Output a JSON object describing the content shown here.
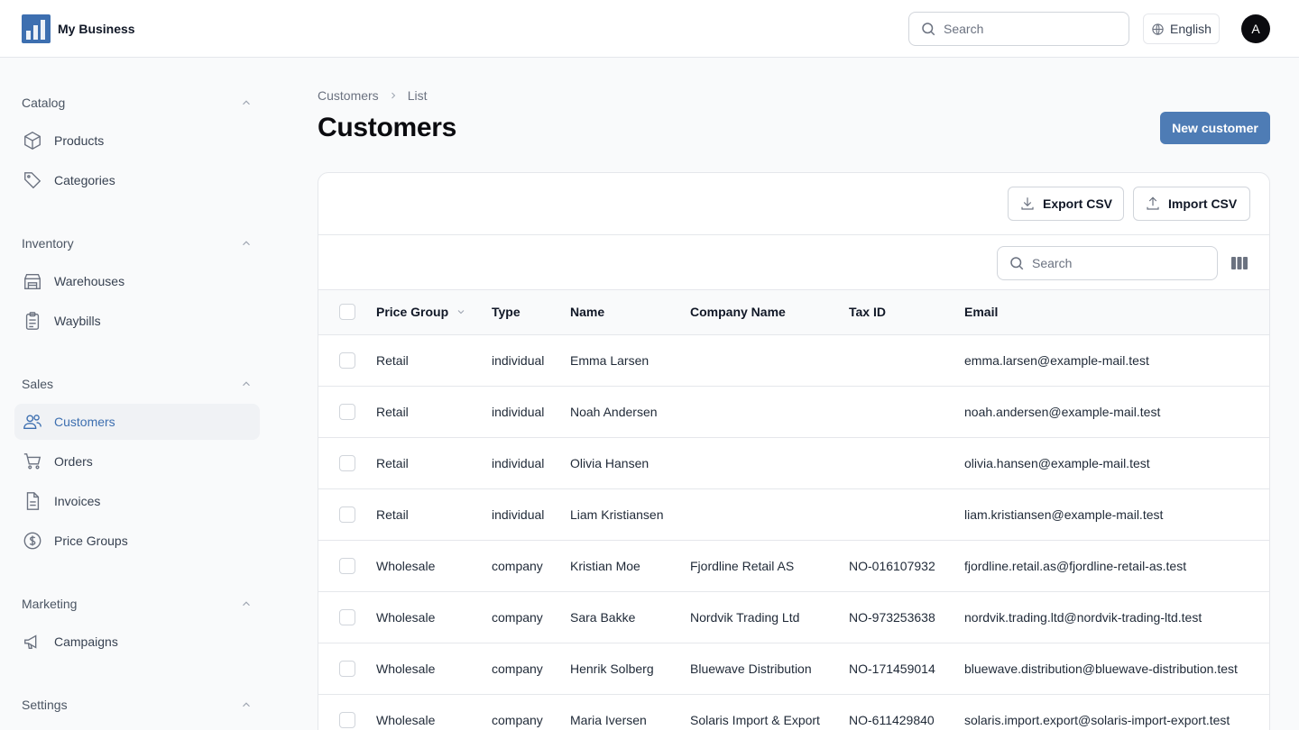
{
  "brand": {
    "name": "My Business"
  },
  "header": {
    "search_placeholder": "Search",
    "language": "English",
    "avatar_initial": "A"
  },
  "sidebar": {
    "groups": [
      {
        "label": "Catalog",
        "items": [
          {
            "label": "Products",
            "icon": "box-icon"
          },
          {
            "label": "Categories",
            "icon": "tag-icon"
          }
        ]
      },
      {
        "label": "Inventory",
        "items": [
          {
            "label": "Warehouses",
            "icon": "warehouse-icon"
          },
          {
            "label": "Waybills",
            "icon": "clipboard-icon"
          }
        ]
      },
      {
        "label": "Sales",
        "items": [
          {
            "label": "Customers",
            "icon": "users-icon",
            "active": true
          },
          {
            "label": "Orders",
            "icon": "cart-icon"
          },
          {
            "label": "Invoices",
            "icon": "document-icon"
          },
          {
            "label": "Price Groups",
            "icon": "dollar-icon"
          }
        ]
      },
      {
        "label": "Marketing",
        "items": [
          {
            "label": "Campaigns",
            "icon": "megaphone-icon"
          }
        ]
      },
      {
        "label": "Settings",
        "items": []
      }
    ]
  },
  "breadcrumb": {
    "parent": "Customers",
    "current": "List"
  },
  "page": {
    "title": "Customers",
    "new_button": "New customer"
  },
  "toolbar": {
    "export_label": "Export CSV",
    "import_label": "Import CSV"
  },
  "table": {
    "search_placeholder": "Search",
    "columns": [
      "Price Group",
      "Type",
      "Name",
      "Company Name",
      "Tax ID",
      "Email"
    ],
    "rows": [
      {
        "price_group": "Retail",
        "type": "individual",
        "name": "Emma Larsen",
        "company": "",
        "tax_id": "",
        "email": "emma.larsen@example-mail.test"
      },
      {
        "price_group": "Retail",
        "type": "individual",
        "name": "Noah Andersen",
        "company": "",
        "tax_id": "",
        "email": "noah.andersen@example-mail.test"
      },
      {
        "price_group": "Retail",
        "type": "individual",
        "name": "Olivia Hansen",
        "company": "",
        "tax_id": "",
        "email": "olivia.hansen@example-mail.test"
      },
      {
        "price_group": "Retail",
        "type": "individual",
        "name": "Liam Kristiansen",
        "company": "",
        "tax_id": "",
        "email": "liam.kristiansen@example-mail.test"
      },
      {
        "price_group": "Wholesale",
        "type": "company",
        "name": "Kristian Moe",
        "company": "Fjordline Retail AS",
        "tax_id": "NO-016107932",
        "email": "fjordline.retail.as@fjordline-retail-as.test"
      },
      {
        "price_group": "Wholesale",
        "type": "company",
        "name": "Sara Bakke",
        "company": "Nordvik Trading Ltd",
        "tax_id": "NO-973253638",
        "email": "nordvik.trading.ltd@nordvik-trading-ltd.test"
      },
      {
        "price_group": "Wholesale",
        "type": "company",
        "name": "Henrik Solberg",
        "company": "Bluewave Distribution",
        "tax_id": "NO-171459014",
        "email": "bluewave.distribution@bluewave-distribution.test"
      },
      {
        "price_group": "Wholesale",
        "type": "company",
        "name": "Maria Iversen",
        "company": "Solaris Import & Export",
        "tax_id": "NO-611429840",
        "email": "solaris.import.export@solaris-import-export.test"
      }
    ]
  },
  "colors": {
    "accent": "#3d6fb0",
    "primary_button": "#4e7cb5",
    "border": "#e5e7eb"
  }
}
